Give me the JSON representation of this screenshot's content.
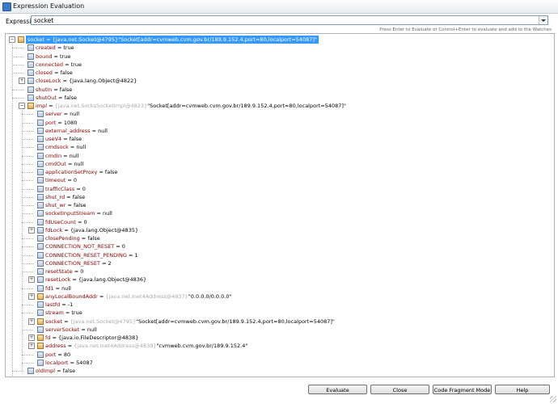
{
  "window": {
    "title": "Expression Evaluation"
  },
  "expression": {
    "label": "Expression:",
    "value": "socket"
  },
  "hint": "Press Enter to Evaluate or Control+Enter to evaluate and add to the Watches",
  "tree": [
    {
      "depth": 0,
      "expander": "minus",
      "icon": "obj",
      "selected": true,
      "name": "socket",
      "value": " = {java.net.Socket@4795}\"Socket[addr=cvmweb.cvm.gov.br/189.9.152.4,port=80,localport=54087]\""
    },
    {
      "depth": 1,
      "icon": "field",
      "name": "created",
      "value": " = true"
    },
    {
      "depth": 1,
      "icon": "field",
      "name": "bound",
      "value": " = true"
    },
    {
      "depth": 1,
      "icon": "field",
      "name": "connected",
      "value": " = true"
    },
    {
      "depth": 1,
      "icon": "field",
      "name": "closed",
      "value": " = false"
    },
    {
      "depth": 1,
      "expander": "plus",
      "icon": "field",
      "name": "closeLock",
      "value": " = {java.lang.Object@4822}"
    },
    {
      "depth": 1,
      "icon": "field",
      "name": "shutIn",
      "value": " = false"
    },
    {
      "depth": 1,
      "icon": "field",
      "name": "shutOut",
      "value": " = false"
    },
    {
      "depth": 1,
      "expander": "minus",
      "icon": "obj",
      "name": "impl",
      "value": " = ",
      "gray": "{java.net.SocksSocketImpl@4823}",
      "value2": "\"Socket[addr=cvmweb.cvm.gov.br/189.9.152.4,port=80,localport=54087]\""
    },
    {
      "depth": 2,
      "icon": "field",
      "name": "server",
      "value": " = null"
    },
    {
      "depth": 2,
      "icon": "field",
      "name": "port",
      "value": " = 1080"
    },
    {
      "depth": 2,
      "icon": "field",
      "name": "external_address",
      "value": " = null"
    },
    {
      "depth": 2,
      "icon": "field",
      "name": "useV4",
      "value": " = false"
    },
    {
      "depth": 2,
      "icon": "field",
      "name": "cmdsock",
      "value": " = null"
    },
    {
      "depth": 2,
      "icon": "field",
      "name": "cmdIn",
      "value": " = null"
    },
    {
      "depth": 2,
      "icon": "field",
      "name": "cmdOut",
      "value": " = null"
    },
    {
      "depth": 2,
      "icon": "field",
      "name": "applicationSetProxy",
      "value": " = false"
    },
    {
      "depth": 2,
      "icon": "field",
      "name": "timeout",
      "value": " = 0"
    },
    {
      "depth": 2,
      "icon": "field",
      "name": "trafficClass",
      "value": " = 0"
    },
    {
      "depth": 2,
      "icon": "field",
      "name": "shut_rd",
      "value": " = false"
    },
    {
      "depth": 2,
      "icon": "field",
      "name": "shut_wr",
      "value": " = false"
    },
    {
      "depth": 2,
      "icon": "field",
      "name": "socketInputStream",
      "value": " = null"
    },
    {
      "depth": 2,
      "icon": "field",
      "name": "fdUseCount",
      "value": " = 0"
    },
    {
      "depth": 2,
      "expander": "plus",
      "icon": "field",
      "name": "fdLock",
      "value": " = {java.lang.Object@4835}"
    },
    {
      "depth": 2,
      "icon": "field",
      "name": "closePending",
      "value": " = false"
    },
    {
      "depth": 2,
      "icon": "field",
      "name": "CONNECTION_NOT_RESET",
      "value": " = 0"
    },
    {
      "depth": 2,
      "icon": "field",
      "name": "CONNECTION_RESET_PENDING",
      "value": " = 1"
    },
    {
      "depth": 2,
      "icon": "field",
      "name": "CONNECTION_RESET",
      "value": " = 2"
    },
    {
      "depth": 2,
      "icon": "field",
      "name": "resetState",
      "value": " = 0"
    },
    {
      "depth": 2,
      "expander": "plus",
      "icon": "field",
      "name": "resetLock",
      "value": " = {java.lang.Object@4836}"
    },
    {
      "depth": 2,
      "icon": "field",
      "name": "fd1",
      "value": " = null"
    },
    {
      "depth": 2,
      "expander": "plus",
      "icon": "obj",
      "name": "anyLocalBoundAddr",
      "value": " = ",
      "gray": "{java.net.Inet4Address@4837}",
      "value2": "\"0.0.0.0/0.0.0.0\""
    },
    {
      "depth": 2,
      "icon": "field",
      "name": "lastfd",
      "value": " = -1"
    },
    {
      "depth": 2,
      "icon": "field",
      "name": "stream",
      "value": " = true"
    },
    {
      "depth": 2,
      "expander": "plus",
      "icon": "obj",
      "name": "socket",
      "value": " = ",
      "gray": "{java.net.Socket@4795}",
      "value2": "\"Socket[addr=cvmweb.cvm.gov.br/189.9.152.4,port=80,localport=54087]\""
    },
    {
      "depth": 2,
      "icon": "field",
      "name": "serverSocket",
      "value": " = null"
    },
    {
      "depth": 2,
      "expander": "plus",
      "icon": "obj",
      "name": "fd",
      "value": " = {java.io.FileDescriptor@4838}"
    },
    {
      "depth": 2,
      "expander": "plus",
      "icon": "obj",
      "name": "address",
      "value": " = ",
      "gray": "{java.net.Inet4Address@4839}",
      "value2": "\"cvmweb.cvm.gov.br/189.9.152.4\""
    },
    {
      "depth": 2,
      "icon": "field",
      "name": "port",
      "value": " = 80"
    },
    {
      "depth": 2,
      "icon": "field",
      "name": "localport",
      "value": " = 54087"
    },
    {
      "depth": 1,
      "icon": "field",
      "name": "oldImpl",
      "value": " = false"
    }
  ],
  "buttons": {
    "evaluate": "Evaluate",
    "close": "Close",
    "code_fragment": "Code Fragment Mode",
    "help": "Help"
  },
  "colors": {
    "selection": "#3399ff",
    "field_name": "#8b0000"
  }
}
